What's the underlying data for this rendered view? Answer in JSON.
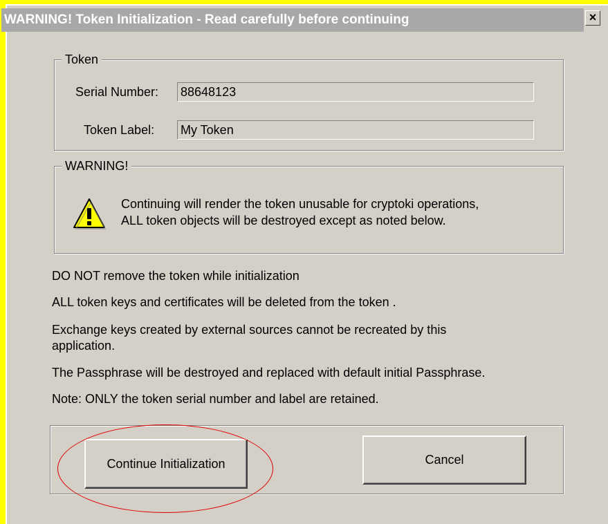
{
  "window": {
    "title": "WARNING!  Token Initialization  - Read carefully before continuing",
    "close_glyph": "×",
    "close_label": "X"
  },
  "token_group": {
    "legend": "Token",
    "serial_label": "Serial Number:",
    "serial_value": "88648123",
    "label_label": "Token Label:",
    "label_value": "My Token"
  },
  "warning_group": {
    "legend": "WARNING!",
    "icon": "warning-triangle-icon",
    "line1": "Continuing will render the token unusable for cryptoki operations,",
    "line2": "ALL token objects will be destroyed except as noted below."
  },
  "notes": {
    "n1": "DO NOT remove the token while initialization",
    "n2": "ALL token keys and certificates will be deleted from the token .",
    "n3a": "Exchange keys created by external sources cannot be recreated by this",
    "n3b": "application.",
    "n4": "The Passphrase will be destroyed and replaced with default initial Passphrase.",
    "n5": "Note: ONLY the token serial number and label are retained."
  },
  "buttons": {
    "continue_label": "Continue Initialization",
    "cancel_label": "Cancel"
  },
  "colors": {
    "dialog_bg": "#d4d0c8",
    "title_bar": "#a8a8a8",
    "annotation_red": "#e00000",
    "page_border": "#ffff00"
  }
}
